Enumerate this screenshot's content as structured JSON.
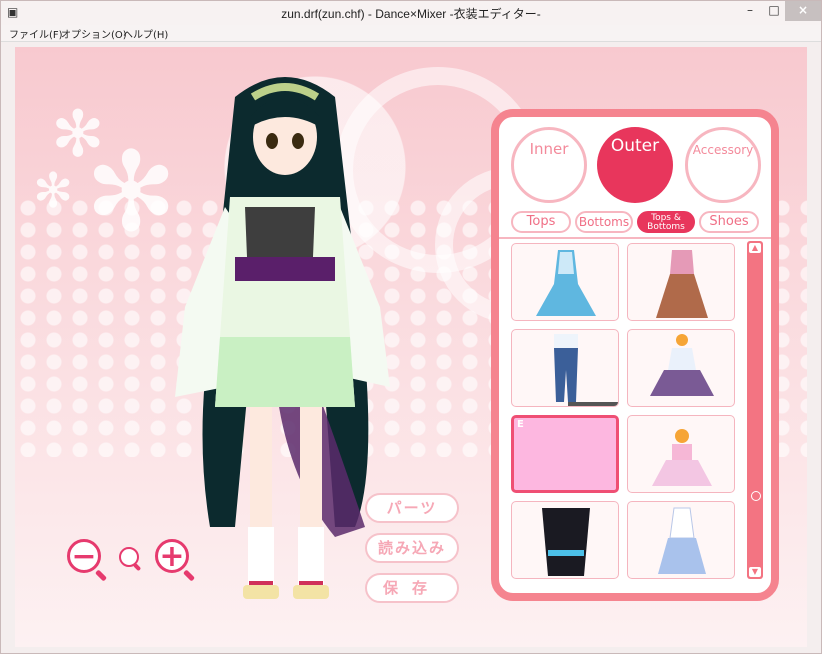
{
  "window": {
    "title": "zun.drf(zun.chf) - Dance×Mixer -衣装エディター-",
    "minimize": "–",
    "maximize": "□",
    "close": "×"
  },
  "menu": [
    "ファイル(F)",
    "オプション(O)",
    "ヘルプ(H)"
  ],
  "panel": {
    "main_tabs": [
      "Inner",
      "Outer",
      "Accessory"
    ],
    "selected_main_tab": "Outer",
    "category_tabs": [
      "Tops",
      "Bottoms",
      "Tops & Bottoms",
      "Shoes"
    ],
    "selected_category_tab": "Tops & Bottoms",
    "grid_selected_label": "E"
  },
  "actions": {
    "parts": "パーツ",
    "load": "読み込み",
    "save": "保存"
  },
  "colors": {
    "accent": "#e8365c",
    "panel_border": "#f5848f",
    "background": "#f8c9cf"
  }
}
